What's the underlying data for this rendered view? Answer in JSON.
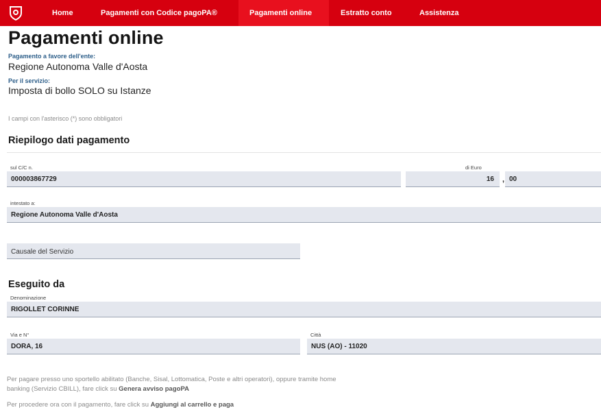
{
  "nav": {
    "items": [
      {
        "label": "Home",
        "active": false
      },
      {
        "label": "Pagamenti con Codice pagoPA®",
        "active": false
      },
      {
        "label": "Pagamenti online",
        "active": true
      },
      {
        "label": "Estratto conto",
        "active": false
      },
      {
        "label": "Assistenza",
        "active": false
      }
    ],
    "background": "#d6000f",
    "logo_icon": "regional-coat-of-arms-icon"
  },
  "page": {
    "title": "Pagamenti online",
    "ente_label": "Pagamento a favore dell'ente:",
    "ente_value": "Regione Autonoma Valle d'Aosta",
    "servizio_label": "Per il servizio:",
    "servizio_value": "Imposta di bollo SOLO su Istanze",
    "required_hint": "I campi con l'asterisco (*) sono obbligatori"
  },
  "riepilogo": {
    "title": "Riepilogo dati pagamento",
    "cc_label": "sul C/C n.",
    "cc_value": "000003867729",
    "euro_label": "di Euro",
    "euro_integer": "16",
    "euro_separator": ",",
    "euro_cents": "00",
    "intestato_label": "intestato a:",
    "intestato_value": "Regione Autonoma Valle d'Aosta",
    "causale_placeholder": "Causale del Servizio"
  },
  "eseguito": {
    "title": "Eseguito da",
    "denominazione_label": "Denominazione",
    "denominazione_value": "RIGOLLET CORINNE",
    "via_label": "Via e N°",
    "via_value": "DORA, 16",
    "citta_label": "Città",
    "citta_value": "NUS (AO) - 11020"
  },
  "instructions": {
    "line1": "Per pagare presso uno sportello abilitato (Banche, Sisal, Lottomatica, Poste e altri operatori), oppure tramite home",
    "line2_prefix": "banking (Servizio CBILL), fare click su ",
    "line2_bold": "Genera avviso pagoPA",
    "line3_prefix": "Per procedere ora con il pagamento, fare click su ",
    "line3_bold": "Aggiungi al carrello e paga"
  }
}
